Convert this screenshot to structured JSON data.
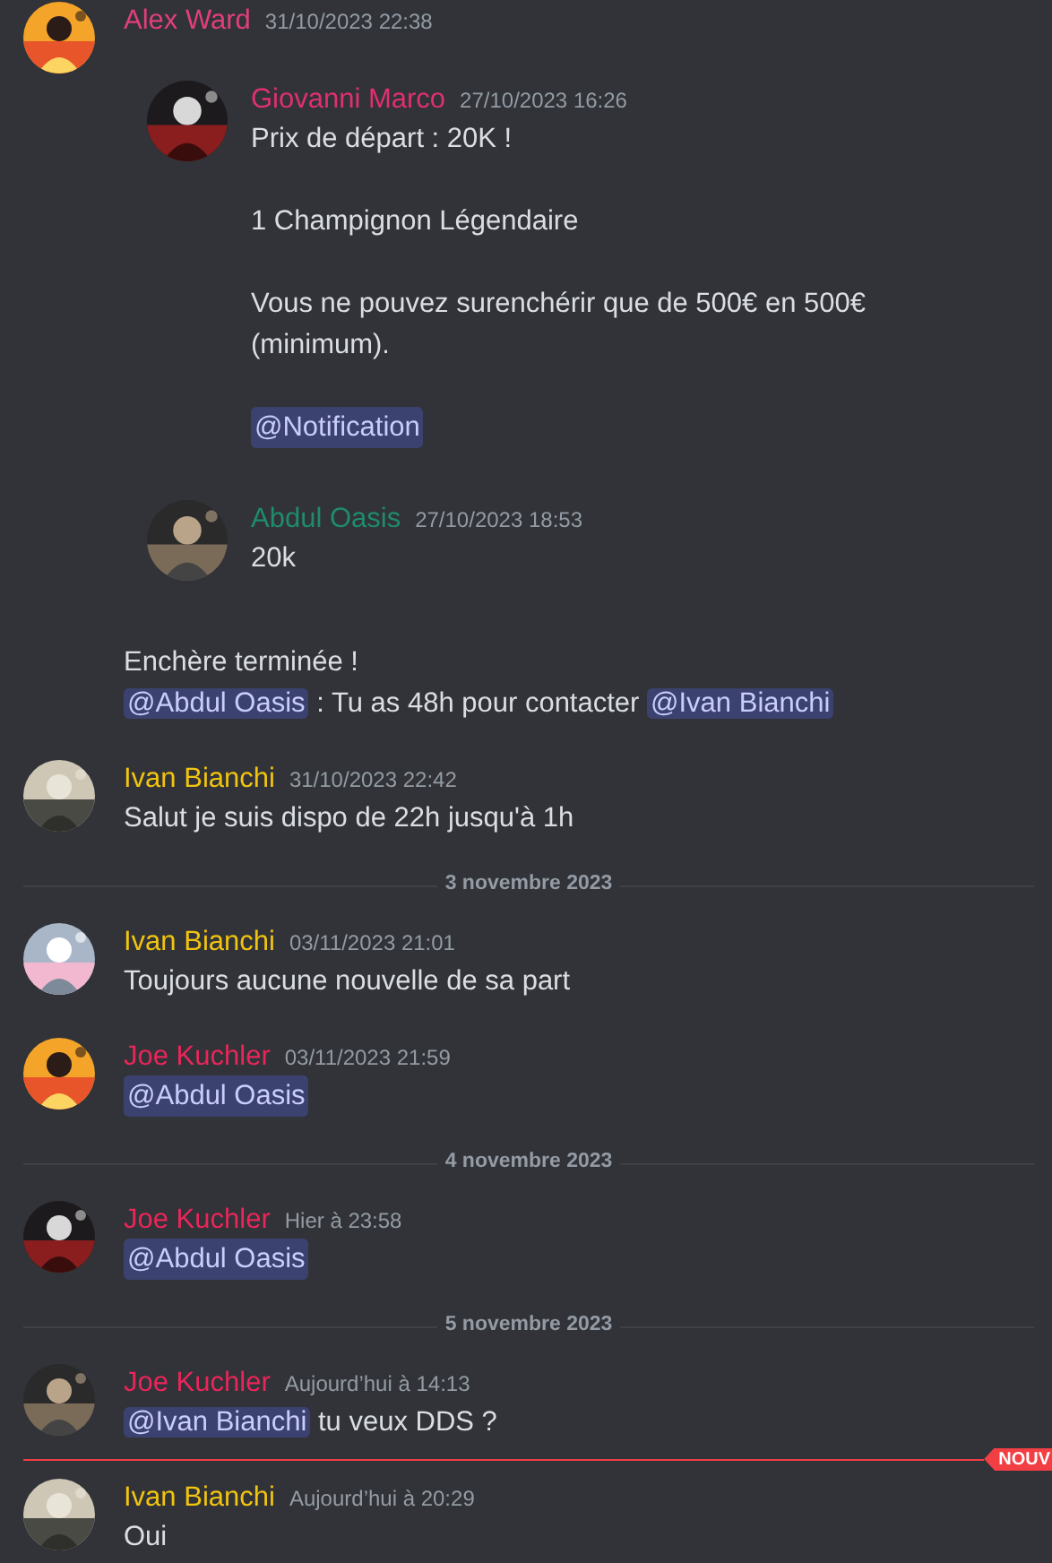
{
  "messages": [
    {
      "kind": "message",
      "author": "Alex Ward",
      "color": "#e23f7a",
      "timestamp": "31/10/2023 22:38",
      "embeds": [
        {
          "author": "Giovanni Marco",
          "color": "#e0306f",
          "timestamp": "27/10/2023 16:26",
          "paragraphs": [
            [
              {
                "kind": "text",
                "text": "Prix de départ : 20K !"
              }
            ],
            [
              {
                "kind": "text",
                "text": "1 Champignon Légendaire"
              }
            ],
            [
              {
                "kind": "text",
                "text": "Vous ne pouvez surenchérir que de 500€ en 500€ (minimum)."
              }
            ],
            [
              {
                "kind": "mention",
                "text": "@Notification"
              }
            ]
          ]
        },
        {
          "author": "Abdul Oasis",
          "color": "#1f8b6b",
          "timestamp": "27/10/2023 18:53",
          "paragraphs": [
            [
              {
                "kind": "text",
                "text": "20k"
              }
            ]
          ]
        }
      ],
      "paragraphs": [
        [
          {
            "kind": "text",
            "text": "Enchère terminée !"
          }
        ],
        [
          {
            "kind": "mention",
            "text": "@Abdul Oasis"
          },
          {
            "kind": "text",
            "text": " : Tu as 48h pour contacter "
          },
          {
            "kind": "mention",
            "text": "@Ivan Bianchi"
          }
        ]
      ]
    },
    {
      "kind": "message",
      "author": "Ivan Bianchi",
      "color": "#f1c40f",
      "timestamp": "31/10/2023 22:42",
      "paragraphs": [
        [
          {
            "kind": "text",
            "text": "Salut je suis dispo de 22h jusqu'à 1h"
          }
        ]
      ]
    },
    {
      "kind": "date_divider",
      "label": "3 novembre 2023"
    },
    {
      "kind": "message",
      "author": "Ivan Bianchi",
      "color": "#f1c40f",
      "timestamp": "03/11/2023 21:01",
      "paragraphs": [
        [
          {
            "kind": "text",
            "text": "Toujours aucune nouvelle de sa part"
          }
        ]
      ]
    },
    {
      "kind": "message",
      "author": "Joe Kuchler",
      "color": "#e9265a",
      "timestamp": "03/11/2023 21:59",
      "paragraphs": [
        [
          {
            "kind": "mention",
            "text": "@Abdul Oasis"
          }
        ]
      ]
    },
    {
      "kind": "date_divider",
      "label": "4 novembre 2023"
    },
    {
      "kind": "message",
      "author": "Joe Kuchler",
      "color": "#e9265a",
      "timestamp": "Hier à 23:58",
      "paragraphs": [
        [
          {
            "kind": "mention",
            "text": "@Abdul Oasis"
          }
        ]
      ]
    },
    {
      "kind": "date_divider",
      "label": "5 novembre 2023"
    },
    {
      "kind": "message",
      "author": "Joe Kuchler",
      "color": "#e9265a",
      "timestamp": "Aujourd’hui à 14:13",
      "paragraphs": [
        [
          {
            "kind": "mention",
            "text": "@Ivan Bianchi"
          },
          {
            "kind": "text",
            "text": " tu veux DDS ?"
          }
        ]
      ]
    },
    {
      "kind": "new_divider",
      "label": "NOUV"
    },
    {
      "kind": "message",
      "author": "Ivan Bianchi",
      "color": "#f1c40f",
      "timestamp": "Aujourd’hui à 20:29",
      "paragraphs": [
        [
          {
            "kind": "text",
            "text": "Oui"
          }
        ]
      ]
    }
  ]
}
